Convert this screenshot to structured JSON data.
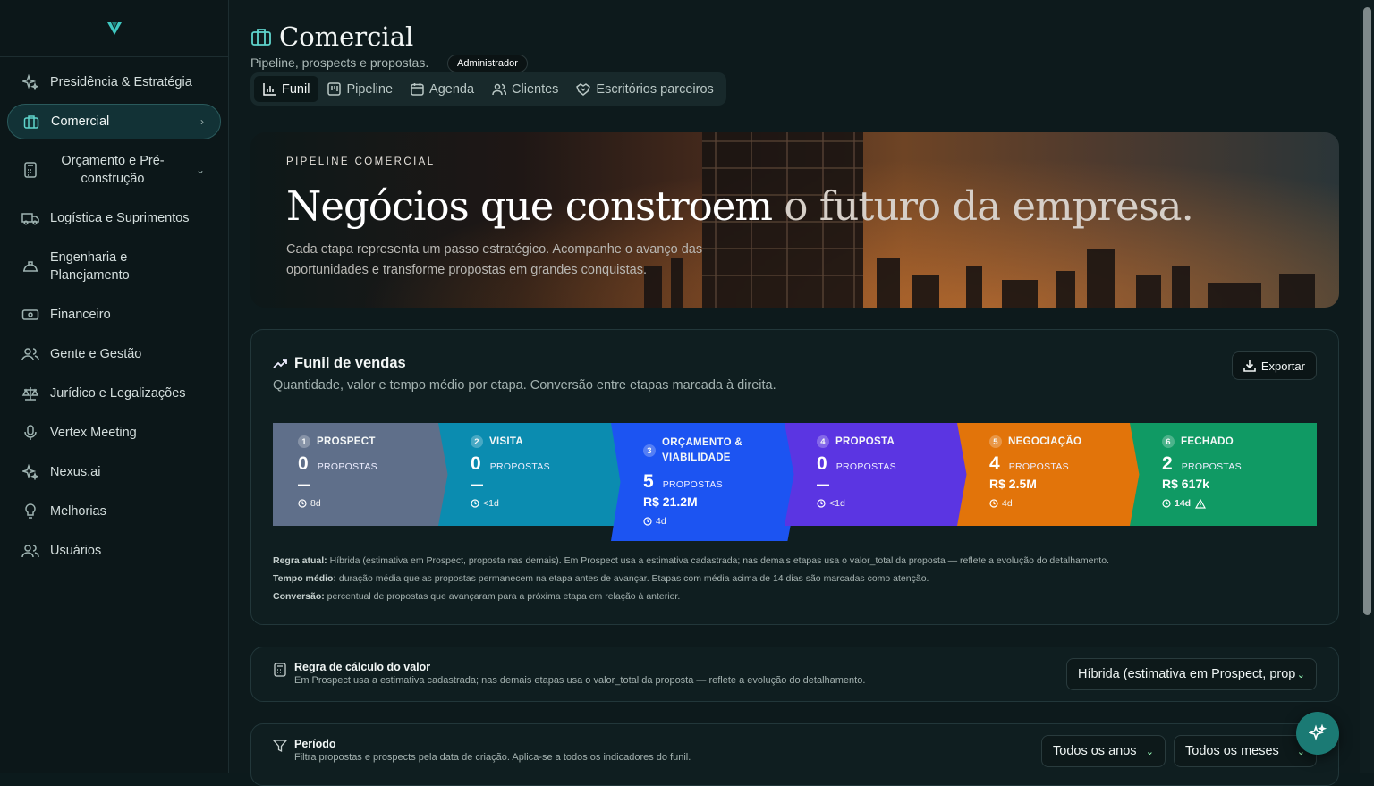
{
  "sidebar": {
    "logo": "V",
    "items": [
      {
        "label": "Presidência & Estratégia",
        "icon": "sparkles-icon"
      },
      {
        "label": "Comercial",
        "icon": "briefcase-icon"
      },
      {
        "label": "Orçamento e Pré-construção",
        "icon": "calculator-icon"
      },
      {
        "label": "Logística e Suprimentos",
        "icon": "truck-icon"
      },
      {
        "label": "Engenharia e Planejamento",
        "icon": "hard-hat-icon"
      },
      {
        "label": "Financeiro",
        "icon": "banknote-icon"
      },
      {
        "label": "Gente e Gestão",
        "icon": "users-icon"
      },
      {
        "label": "Jurídico e Legalizações",
        "icon": "scale-icon"
      },
      {
        "label": "Vertex Meeting",
        "icon": "mic-icon"
      },
      {
        "label": "Nexus.ai",
        "icon": "sparkles-icon"
      },
      {
        "label": "Melhorias",
        "icon": "lightbulb-icon"
      },
      {
        "label": "Usuários",
        "icon": "users-icon"
      }
    ]
  },
  "header": {
    "title": "Comercial",
    "subtitle": "Pipeline, prospects e propostas.",
    "badge": "Administrador"
  },
  "tabs": [
    "Funil",
    "Pipeline",
    "Agenda",
    "Clientes",
    "Escritórios parceiros"
  ],
  "hero": {
    "eyebrow": "PIPELINE COMERCIAL",
    "headline_a": "Negócios que constroem",
    "headline_b": " o futuro da empresa.",
    "text": "Cada etapa representa um passo estratégico. Acompanhe o avanço das oportunidades e transforme propostas em grandes conquistas."
  },
  "funnel": {
    "title": "Funil de vendas",
    "desc": "Quantidade, valor e tempo médio por etapa. Conversão entre etapas marcada à direita.",
    "export": "Exportar",
    "unit": "PROPOSTAS",
    "stages": [
      {
        "n": "1",
        "name": "PROSPECT",
        "count": "0",
        "value": "—",
        "time": "8d",
        "color": "#5f6f8a"
      },
      {
        "n": "2",
        "name": "VISITA",
        "count": "0",
        "value": "—",
        "time": "<1d",
        "color": "#0b8cb0"
      },
      {
        "n": "3",
        "name": "ORÇAMENTO &",
        "name2": "VIABILIDADE",
        "count": "5",
        "value": "R$ 21.2M",
        "time": "4d",
        "color": "#1c54f2"
      },
      {
        "n": "4",
        "name": "PROPOSTA",
        "count": "0",
        "value": "—",
        "time": "<1d",
        "color": "#5b35e2"
      },
      {
        "n": "5",
        "name": "NEGOCIAÇÃO",
        "count": "4",
        "value": "R$ 2.5M",
        "time": "4d",
        "color": "#e2740a"
      },
      {
        "n": "6",
        "name": "FECHADO",
        "count": "2",
        "value": "R$ 617k",
        "time": "14d",
        "color": "#109a64"
      }
    ],
    "notes": [
      {
        "k": "Regra atual:",
        "v": " Híbrida (estimativa em Prospect, proposta nas demais). Em Prospect usa a estimativa cadastrada; nas demais etapas usa o valor_total da proposta — reflete a evolução do detalhamento."
      },
      {
        "k": "Tempo médio:",
        "v": " duração média que as propostas permanecem na etapa antes de avançar. Etapas com média acima de 14 dias são marcadas como atenção."
      },
      {
        "k": "Conversão:",
        "v": " percentual de propostas que avançaram para a próxima etapa em relação à anterior."
      }
    ]
  },
  "rule": {
    "title": "Regra de cálculo do valor",
    "desc": "Em Prospect usa a estimativa cadastrada; nas demais etapas usa o valor_total da proposta — reflete a evolução do detalhamento.",
    "select": "Híbrida (estimativa em Prospect, proposta"
  },
  "period": {
    "title": "Período",
    "desc": "Filtra propostas e prospects pela data de criação. Aplica-se a todos os indicadores do funil.",
    "year": "Todos os anos",
    "month": "Todos os meses"
  }
}
